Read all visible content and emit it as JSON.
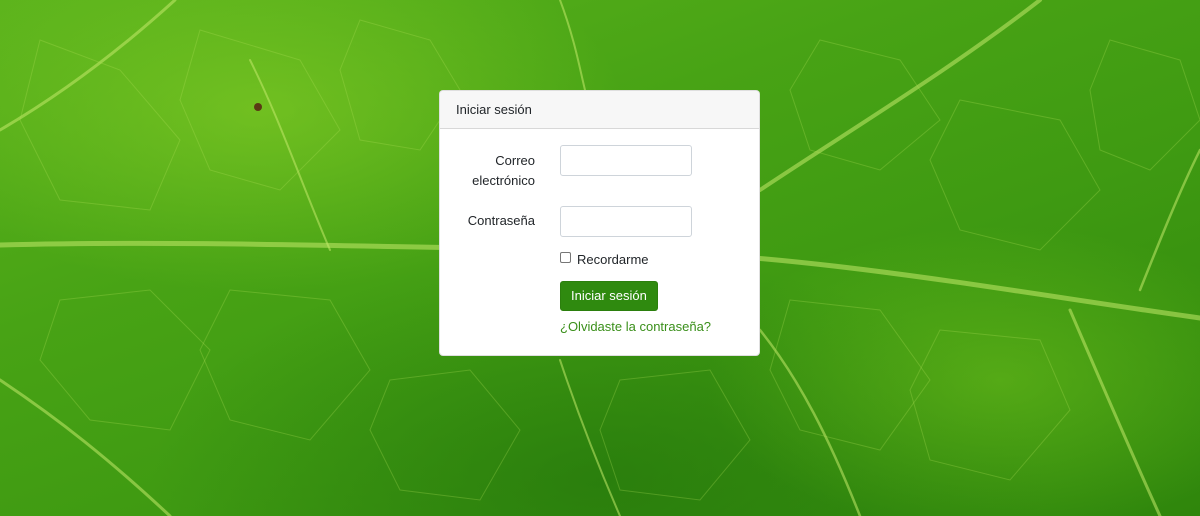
{
  "background": {
    "description_icon": "leaf-texture-background",
    "base_color": "#46a314",
    "vein_color": "#b6e35a"
  },
  "login_card": {
    "header_title": "Iniciar sesión",
    "email_label_line1": "Correo",
    "email_label_line2": "electrónico",
    "email_value": "",
    "password_label": "Contraseña",
    "password_value": "",
    "remember_label": "Recordarme",
    "remember_checked": false,
    "submit_label": "Iniciar sesión",
    "forgot_link": "¿Olvidaste la contraseña?",
    "accent_color": "#2f8a0f"
  }
}
